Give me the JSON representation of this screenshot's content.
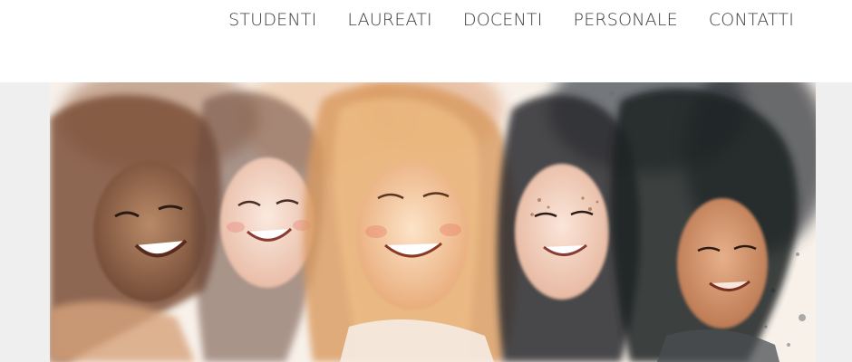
{
  "nav": {
    "items": [
      {
        "label": "STUDENTI"
      },
      {
        "label": "LAUREATI"
      },
      {
        "label": "DOCENTI"
      },
      {
        "label": "PERSONALE"
      },
      {
        "label": "CONTATTI"
      }
    ]
  },
  "colors": {
    "nav_text": "#3a3a3a",
    "page_background": "#efefef",
    "header_background": "#ffffff"
  },
  "hero": {
    "image": "watercolor-illustration-smiling-women"
  }
}
